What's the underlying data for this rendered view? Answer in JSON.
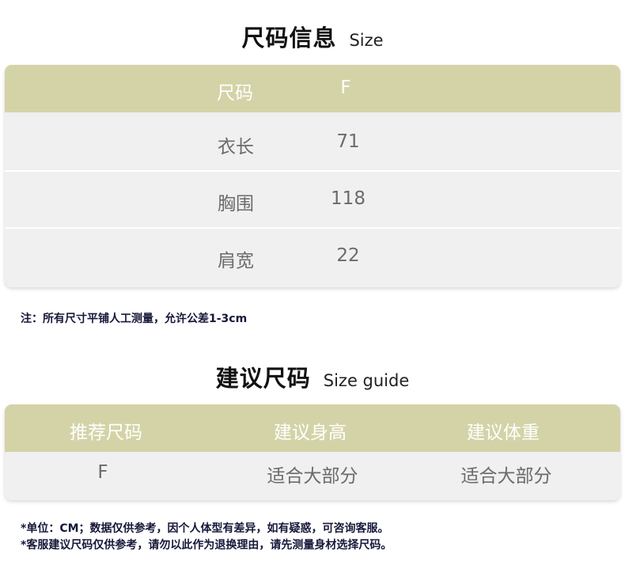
{
  "size_info": {
    "title_cn": "尺码信息",
    "title_en": "Size",
    "header": [
      "尺码",
      "F"
    ],
    "rows": [
      [
        "衣长",
        "71"
      ],
      [
        "胸围",
        "118"
      ],
      [
        "肩宽",
        "22"
      ]
    ],
    "note": "注：所有尺寸平铺人工测量，允许公差1-3cm"
  },
  "size_guide": {
    "title_cn": "建议尺码",
    "title_en": "Size guide",
    "header": [
      "推荐尺码",
      "建议身高",
      "建议体重"
    ],
    "rows": [
      [
        "F",
        "适合大部分",
        "适合大部分"
      ]
    ],
    "notes": [
      "*单位：CM；数据仅供参考，因个人体型有差异，如有疑惑，可咨询客服。",
      "*客服建议尺码仅供参考，请勿以此作为退换理由，请先测量身材选择尺码。"
    ]
  },
  "colors": {
    "header_bg": "#d4d3a8",
    "row_bg": "#f0f0f0",
    "note_text": "#16183a"
  }
}
